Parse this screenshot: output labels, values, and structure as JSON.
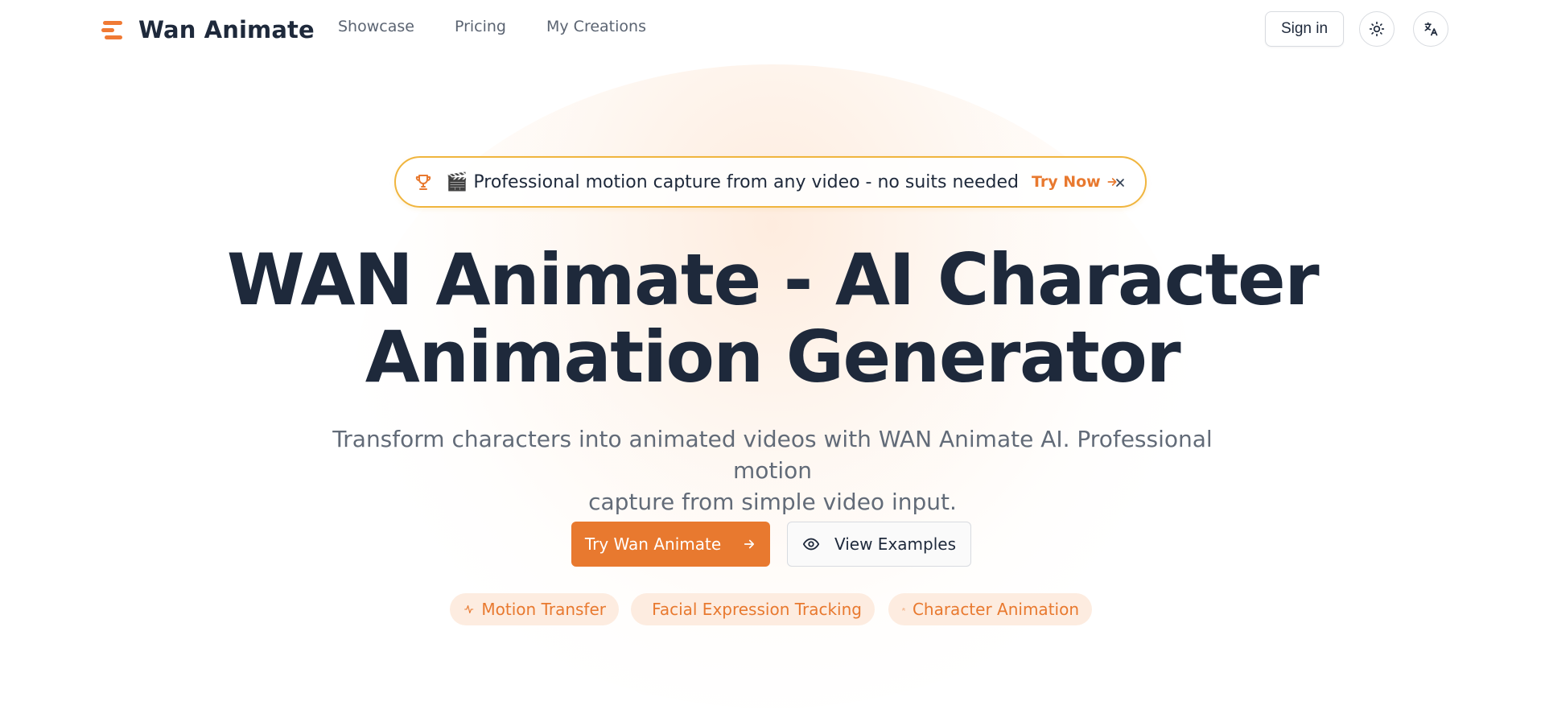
{
  "header": {
    "brand": "Wan Animate",
    "nav": [
      {
        "label": "Showcase"
      },
      {
        "label": "Pricing"
      },
      {
        "label": "My Creations"
      }
    ],
    "sign_in": "Sign in",
    "icons": {
      "logo": "stacked-bars-logo-icon",
      "theme": "sun-icon",
      "language": "translate-icon"
    }
  },
  "announcement": {
    "emoji": "🎬",
    "text": "Professional motion capture from any video - no suits needed",
    "cta": "Try Now",
    "icons": {
      "lead": "trophy-icon",
      "cta": "arrow-right-icon",
      "close": "close-icon"
    }
  },
  "hero": {
    "title_line1": "WAN Animate - AI Character",
    "title_line2": "Animation Generator",
    "subtitle_line1": "Transform characters into animated videos with WAN Animate AI. Professional motion",
    "subtitle_line2": "capture from simple video input.",
    "primary_cta": "Try Wan Animate",
    "secondary_cta": "View Examples"
  },
  "features": [
    {
      "label": "Motion Transfer",
      "icon": "activity-icon"
    },
    {
      "label": "Facial Expression Tracking",
      "icon": "video-camera-icon"
    },
    {
      "label": "Character Animation",
      "icon": "users-icon"
    }
  ],
  "colors": {
    "accent": "#e8792f",
    "accent_soft": "#fdece0",
    "announcement_border": "#f0b53e",
    "heading": "#1e293b",
    "muted_text": "#626b78"
  }
}
